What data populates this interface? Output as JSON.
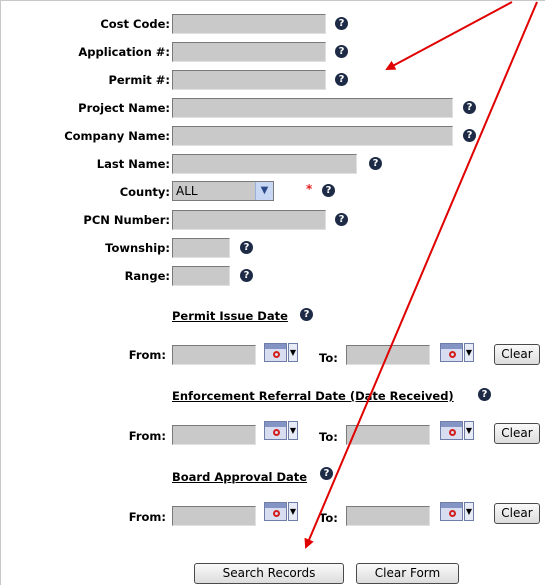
{
  "fields": {
    "cost_code": {
      "label": "Cost Code:",
      "value": ""
    },
    "application": {
      "label": "Application #:",
      "value": ""
    },
    "permit": {
      "label": "Permit #:",
      "value": ""
    },
    "project_name": {
      "label": "Project Name:",
      "value": ""
    },
    "company_name": {
      "label": "Company Name:",
      "value": ""
    },
    "last_name": {
      "label": "Last Name:",
      "value": ""
    },
    "county": {
      "label": "County:",
      "value": "ALL",
      "required_marker": "*"
    },
    "pcn_number": {
      "label": "PCN Number:",
      "value": ""
    },
    "township": {
      "label": "Township:",
      "value": ""
    },
    "range": {
      "label": "Range:",
      "value": ""
    }
  },
  "help_glyph": "?",
  "date_sections": [
    {
      "title": "Permit Issue Date",
      "from_label": "From:",
      "to_label": "To:",
      "clear_label": "Clear"
    },
    {
      "title": "Enforcement Referral Date (Date Received)",
      "from_label": "From:",
      "to_label": "To:",
      "clear_label": "Clear"
    },
    {
      "title": "Board Approval Date",
      "from_label": "From:",
      "to_label": "To:",
      "clear_label": "Clear"
    }
  ],
  "buttons": {
    "search_label": "Search Records",
    "clear_form_label": "Clear Form"
  },
  "colors": {
    "annotation_arrow": "#e00000",
    "help_icon": "#1d2b46",
    "field_bg": "#c9c9c9",
    "required": "#e02020"
  },
  "icons": {
    "help": "question-circle-icon",
    "calendar": "calendar-icon",
    "dropdown": "chevron-down-icon"
  }
}
